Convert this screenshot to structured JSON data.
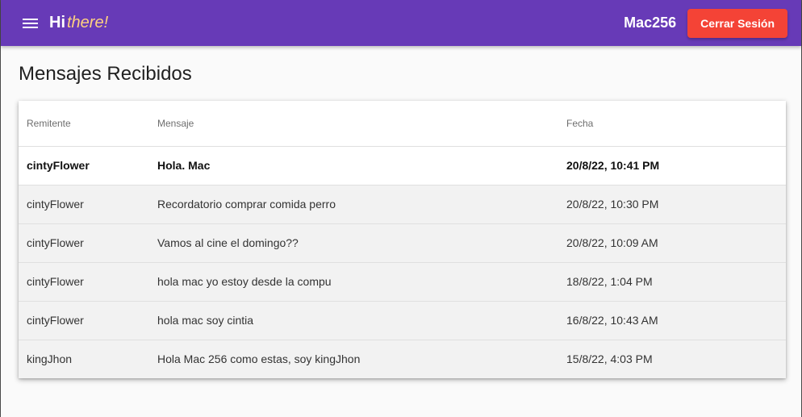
{
  "toolbar": {
    "brand_hi": "Hi",
    "brand_there": "there!",
    "username": "Mac256",
    "logout_label": "Cerrar Sesión"
  },
  "page": {
    "title": "Mensajes Recibidos"
  },
  "table": {
    "columns": [
      "Remitente",
      "Mensaje",
      "Fecha"
    ],
    "rows": [
      {
        "sender": "cintyFlower",
        "message": "Hola. Mac",
        "date": "20/8/22, 10:41 PM",
        "unread": true
      },
      {
        "sender": "cintyFlower",
        "message": "Recordatorio comprar comida perro",
        "date": "20/8/22, 10:30 PM",
        "unread": false
      },
      {
        "sender": "cintyFlower",
        "message": "Vamos al cine el domingo??",
        "date": "20/8/22, 10:09 AM",
        "unread": false
      },
      {
        "sender": "cintyFlower",
        "message": "hola mac yo estoy desde la compu",
        "date": "18/8/22, 1:04 PM",
        "unread": false
      },
      {
        "sender": "cintyFlower",
        "message": "hola mac soy cintia",
        "date": "16/8/22, 10:43 AM",
        "unread": false
      },
      {
        "sender": "kingJhon",
        "message": "Hola Mac 256 como estas, soy kingJhon",
        "date": "15/8/22, 4:03 PM",
        "unread": false
      }
    ]
  },
  "colors": {
    "toolbar": "#673ab7",
    "logout_button": "#f44336",
    "brand_accent": "#ffd180"
  },
  "icons": {
    "menu": "menu-icon"
  }
}
